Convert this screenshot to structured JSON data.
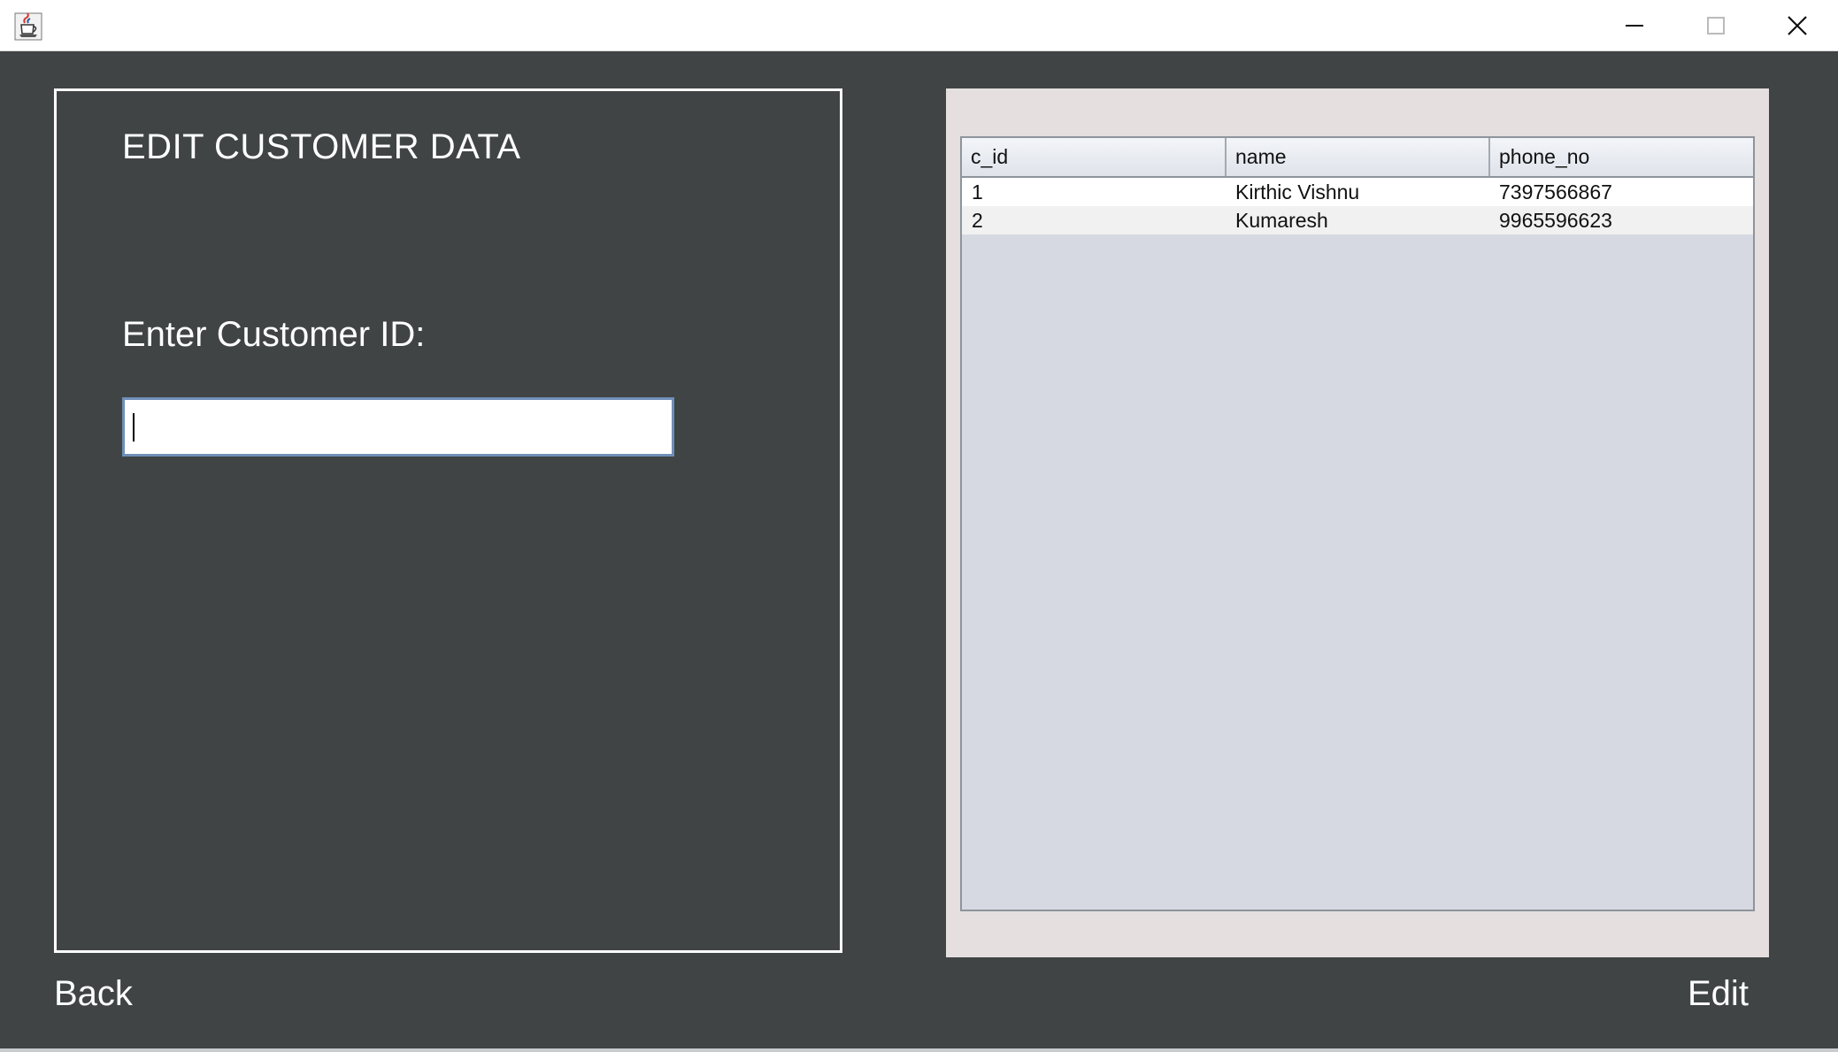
{
  "window": {
    "icon": "java-coffee-icon",
    "controls": {
      "minimize_icon": "minimize-icon",
      "maximize_icon": "maximize-icon",
      "close_icon": "close-icon"
    }
  },
  "left_panel": {
    "title": "EDIT CUSTOMER DATA",
    "id_label": "Enter Customer ID:",
    "id_input": {
      "value": "",
      "placeholder": ""
    }
  },
  "table": {
    "columns": [
      "c_id",
      "name",
      "phone_no"
    ],
    "rows": [
      [
        "1",
        "Kirthic Vishnu",
        "7397566867"
      ],
      [
        "2",
        "Kumaresh",
        "9965596623"
      ]
    ]
  },
  "buttons": {
    "back_label": "Back",
    "edit_label": "Edit"
  },
  "colors": {
    "background": "#404444",
    "panel_border": "#ffffff",
    "table_panel": "#e5dfdf",
    "table_viewport": "#d6d9e1",
    "input_border": "#6f8fb8"
  }
}
